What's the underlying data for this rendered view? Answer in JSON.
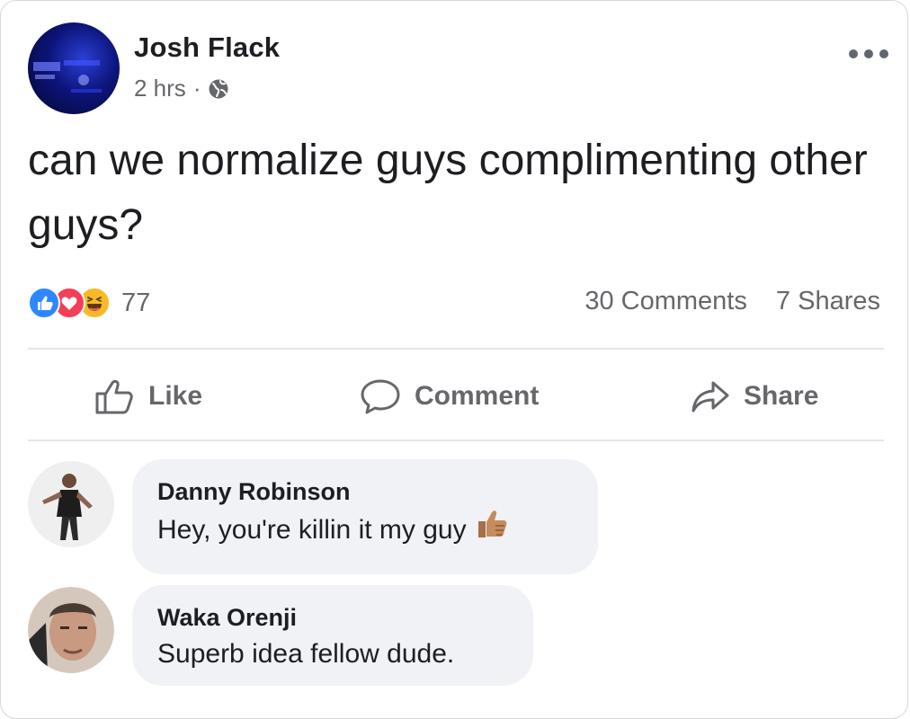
{
  "post": {
    "author": "Josh Flack",
    "time": "2 hrs",
    "separator": "·",
    "privacy_icon": "globe-icon",
    "text": "can we normalize guys complimenting other guys?",
    "reactions": {
      "types": [
        "like",
        "love",
        "haha"
      ],
      "count": "77"
    },
    "comments_count": "30 Comments",
    "shares_count": "7 Shares"
  },
  "actions": {
    "like": "Like",
    "comment": "Comment",
    "share": "Share"
  },
  "comments": [
    {
      "author": "Danny Robinson",
      "text": "Hey, you're killin it my guy",
      "emoji": "thumbs-up-medium-skin"
    },
    {
      "author": "Waka Orenji",
      "text": "Superb idea fellow dude."
    }
  ],
  "colors": {
    "like_blue": "#2d88ff",
    "love_red": "#f33e58",
    "haha_yellow": "#f7b928",
    "secondary_text": "#65676b",
    "bubble_bg": "#f0f2f5"
  }
}
